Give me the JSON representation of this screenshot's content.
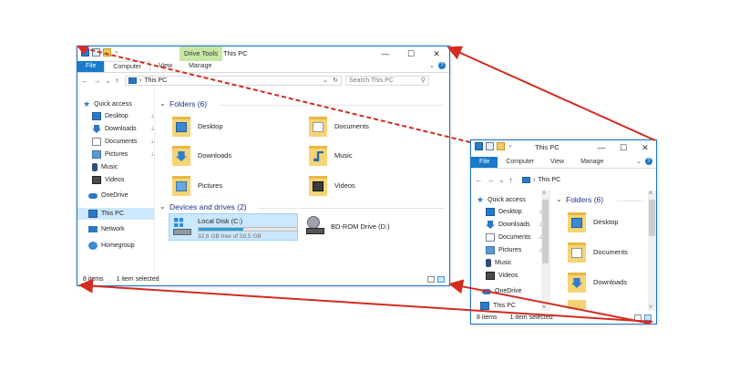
{
  "big": {
    "context_tab": "Drive Tools",
    "title": "This PC",
    "ribbon_tabs": [
      "File",
      "Computer",
      "View",
      "Manage"
    ],
    "address": "This PC",
    "search_placeholder": "Search This PC",
    "nav": [
      {
        "label": "Quick access",
        "icon": "star-icon"
      },
      {
        "label": "Desktop",
        "icon": "desktop-icon",
        "pinned": true
      },
      {
        "label": "Downloads",
        "icon": "downloads-icon",
        "pinned": true
      },
      {
        "label": "Documents",
        "icon": "documents-icon",
        "pinned": true
      },
      {
        "label": "Pictures",
        "icon": "pictures-icon",
        "pinned": true
      },
      {
        "label": "Music",
        "icon": "music-icon"
      },
      {
        "label": "Videos",
        "icon": "videos-icon"
      },
      {
        "label": "OneDrive",
        "icon": "onedrive-icon"
      },
      {
        "label": "This PC",
        "icon": "this-pc-icon",
        "selected": true
      },
      {
        "label": "Network",
        "icon": "network-icon"
      },
      {
        "label": "Homegroup",
        "icon": "homegroup-icon"
      }
    ],
    "folders_header": "Folders (6)",
    "folders": [
      "Desktop",
      "Documents",
      "Downloads",
      "Music",
      "Pictures",
      "Videos"
    ],
    "devices_header": "Devices and drives (2)",
    "drives": [
      {
        "name": "Local Disk (C:)",
        "free": "32,6 GB free of 59,5 GB",
        "used_fraction": 0.45
      },
      {
        "name": "BD-ROM Drive (D:)"
      }
    ],
    "status_items": "8 items",
    "status_selected": "1 item selected"
  },
  "small": {
    "title": "This PC",
    "ribbon_tabs": [
      "File",
      "Computer",
      "View",
      "Manage"
    ],
    "address": "This PC",
    "nav": [
      {
        "label": "Quick access"
      },
      {
        "label": "Desktop",
        "pinned": true
      },
      {
        "label": "Downloads",
        "pinned": true
      },
      {
        "label": "Documents",
        "pinned": true
      },
      {
        "label": "Pictures",
        "pinned": true
      },
      {
        "label": "Music"
      },
      {
        "label": "Videos"
      },
      {
        "label": "OneDrive"
      },
      {
        "label": "This PC"
      }
    ],
    "folders_header": "Folders (6)",
    "folders": [
      "Desktop",
      "Documents",
      "Downloads"
    ],
    "status_items": "8 items",
    "status_selected": "1 item selected"
  },
  "symbols": {
    "minimize": "—",
    "maximize": "☐",
    "close": "✕",
    "back": "←",
    "forward": "→",
    "up": "↑",
    "chevron_down": "⌄",
    "chevron_right": "›",
    "refresh": "↻",
    "search": "⚲",
    "help": "?",
    "pin": "📌",
    "collapse": "⌄",
    "expand_ribbon": "⌄",
    "star": "★",
    "sep": "›",
    "scroll_up": "˄",
    "scroll_down": "˅"
  },
  "colors": {
    "accent": "#1979ca",
    "selection": "#cce8ff",
    "arrow": "#d42a20",
    "context_tab": "#c7e7a5",
    "heading": "#1e3287"
  }
}
